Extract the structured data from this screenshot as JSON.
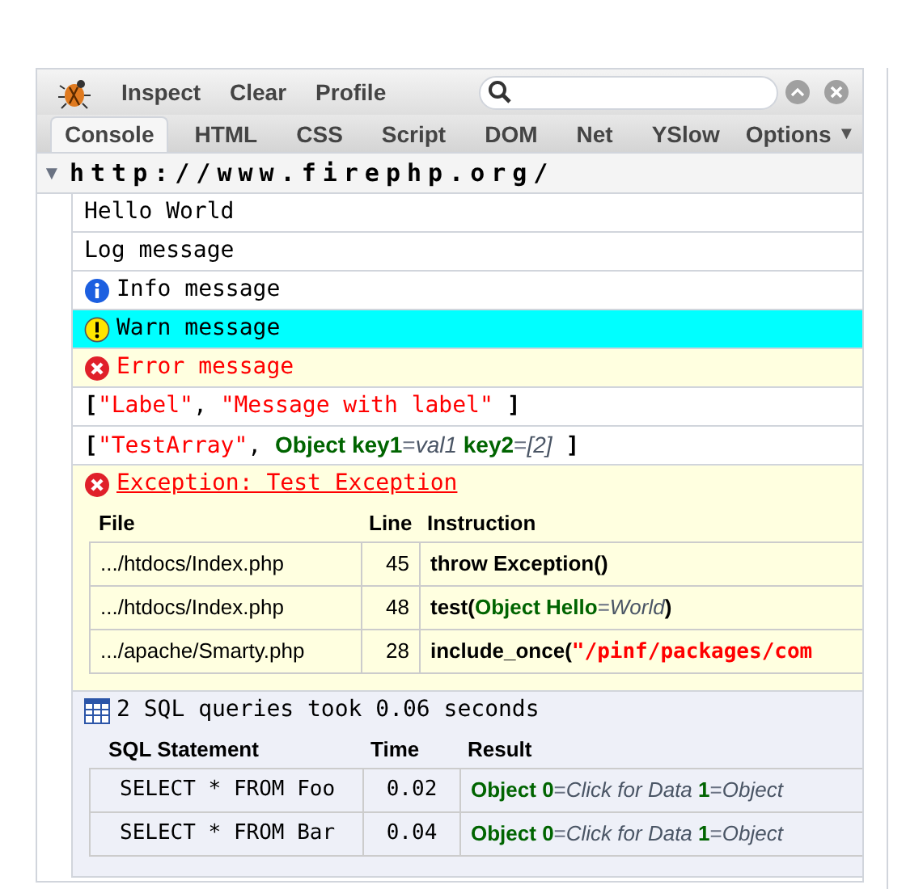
{
  "toolbar": {
    "buttons": [
      "Inspect",
      "Clear",
      "Profile"
    ]
  },
  "tabs": [
    {
      "label": "Console",
      "selected": true
    },
    {
      "label": "HTML",
      "selected": false
    },
    {
      "label": "CSS",
      "selected": false
    },
    {
      "label": "Script",
      "selected": false
    },
    {
      "label": "DOM",
      "selected": false
    },
    {
      "label": "Net",
      "selected": false
    },
    {
      "label": "YSlow",
      "selected": false
    }
  ],
  "options_menu": {
    "label": "Options",
    "arrow": "▼"
  },
  "group": {
    "title": "http://www.firephp.org/",
    "expanded": true,
    "arrow": "▼"
  },
  "log": [
    {
      "kind": "plain",
      "segments": [
        {
          "kind": "text",
          "text": "Hello World"
        }
      ]
    },
    {
      "kind": "plain",
      "segments": [
        {
          "kind": "text",
          "text": "Log message"
        }
      ]
    },
    {
      "kind": "info",
      "segments": [
        {
          "kind": "text",
          "text": "Info message"
        }
      ]
    },
    {
      "kind": "warn",
      "segments": [
        {
          "kind": "text",
          "text": "Warn message"
        }
      ]
    },
    {
      "kind": "error",
      "segments": [
        {
          "kind": "text",
          "text": "Error message"
        }
      ]
    },
    {
      "kind": "plain",
      "segments": [
        {
          "kind": "bracket",
          "text": "["
        },
        {
          "kind": "string",
          "text": "\"Label\""
        },
        {
          "kind": "text",
          "text": ", "
        },
        {
          "kind": "string",
          "text": "\"Message with label\""
        },
        {
          "kind": "bracket",
          "text": " ]"
        }
      ]
    },
    {
      "kind": "plain",
      "segments": [
        {
          "kind": "bracket",
          "text": "["
        },
        {
          "kind": "string",
          "text": "\"TestArray\""
        },
        {
          "kind": "text",
          "text": ", "
        },
        {
          "kind": "object",
          "text": "Object key1"
        },
        {
          "kind": "eq",
          "text": "="
        },
        {
          "kind": "value",
          "text": "val1"
        },
        {
          "kind": "object",
          "text": " key2"
        },
        {
          "kind": "eq",
          "text": "="
        },
        {
          "kind": "value",
          "text": "[2]"
        },
        {
          "kind": "bracket",
          "text": " ]"
        }
      ]
    },
    {
      "kind": "exception",
      "segments": [
        {
          "kind": "text",
          "text": "Exception: Test Exception"
        }
      ],
      "trace": {
        "columns": [
          "File",
          "Line",
          "Instruction"
        ],
        "rows": [
          {
            "file": ".../htdocs/Index.php",
            "line": "45",
            "instruction": [
              {
                "kind": "code",
                "text": "throw Exception()"
              }
            ]
          },
          {
            "file": ".../htdocs/Index.php",
            "line": "48",
            "instruction": [
              {
                "kind": "code",
                "text": "test("
              },
              {
                "kind": "object",
                "text": "Object Hello"
              },
              {
                "kind": "eq",
                "text": "="
              },
              {
                "kind": "value",
                "text": "World"
              },
              {
                "kind": "code",
                "text": ")"
              }
            ]
          },
          {
            "file": ".../apache/Smarty.php",
            "line": "28",
            "instruction": [
              {
                "kind": "code",
                "text": "include_once("
              },
              {
                "kind": "string",
                "text": "\"/pinf/packages/com"
              }
            ]
          }
        ]
      }
    },
    {
      "kind": "sql",
      "segments": [
        {
          "kind": "text",
          "text": "2 SQL queries took 0.06 seconds"
        }
      ],
      "table": {
        "columns": [
          "SQL Statement",
          "Time",
          "Result"
        ],
        "rows": [
          {
            "statement": "SELECT * FROM Foo",
            "time": "0.02",
            "result": [
              {
                "kind": "object",
                "text": "Object 0"
              },
              {
                "kind": "eq",
                "text": "="
              },
              {
                "kind": "value",
                "text": "Click for Data"
              },
              {
                "kind": "object",
                "text": " 1"
              },
              {
                "kind": "eq",
                "text": "="
              },
              {
                "kind": "value",
                "text": "Object"
              }
            ]
          },
          {
            "statement": "SELECT * FROM Bar",
            "time": "0.04",
            "result": [
              {
                "kind": "object",
                "text": "Object 0"
              },
              {
                "kind": "eq",
                "text": "="
              },
              {
                "kind": "value",
                "text": "Click for Data"
              },
              {
                "kind": "object",
                "text": " 1"
              },
              {
                "kind": "eq",
                "text": "="
              },
              {
                "kind": "value",
                "text": "Object"
              }
            ]
          }
        ]
      }
    }
  ]
}
